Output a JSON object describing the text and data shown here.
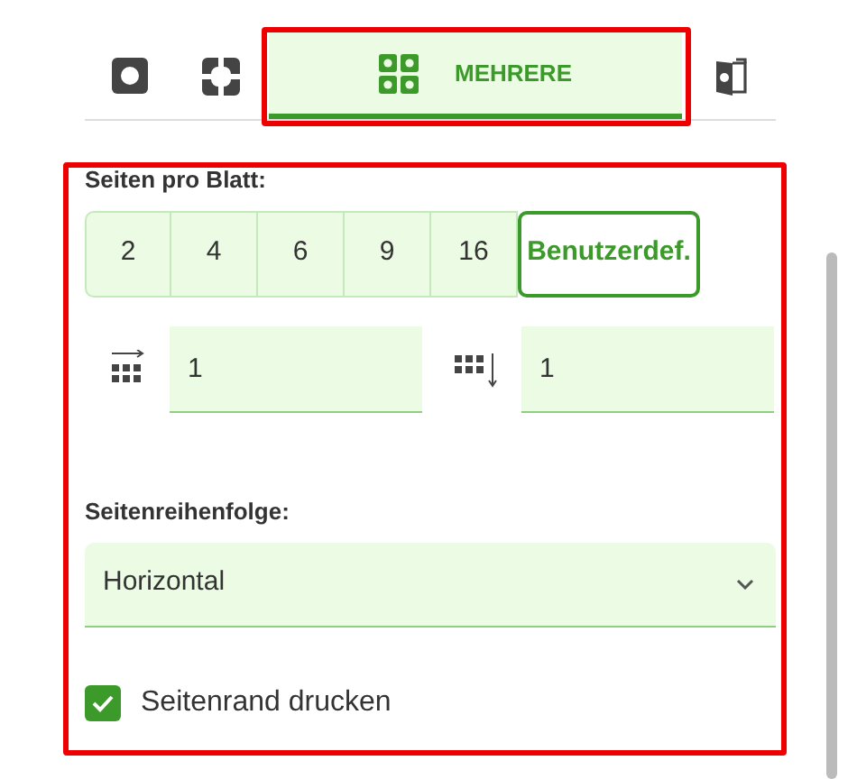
{
  "tabs": [
    {
      "kind": "single",
      "selected": false
    },
    {
      "kind": "split",
      "selected": false
    },
    {
      "kind": "multiple",
      "label": "MEHRERE",
      "selected": true
    },
    {
      "kind": "booklet",
      "selected": false
    }
  ],
  "pages_per_sheet": {
    "label": "Seiten pro Blatt:",
    "options": [
      {
        "label": "2",
        "selected": false
      },
      {
        "label": "4",
        "selected": false
      },
      {
        "label": "6",
        "selected": false
      },
      {
        "label": "9",
        "selected": false
      },
      {
        "label": "16",
        "selected": false
      },
      {
        "label": "Benutzerdef.",
        "selected": true
      }
    ]
  },
  "columns_field": {
    "value": "1"
  },
  "rows_field": {
    "value": "1"
  },
  "page_order": {
    "label": "Seitenreihenfolge:",
    "value": "Horizontal"
  },
  "print_border": {
    "label": "Seitenrand drucken",
    "checked": true
  }
}
